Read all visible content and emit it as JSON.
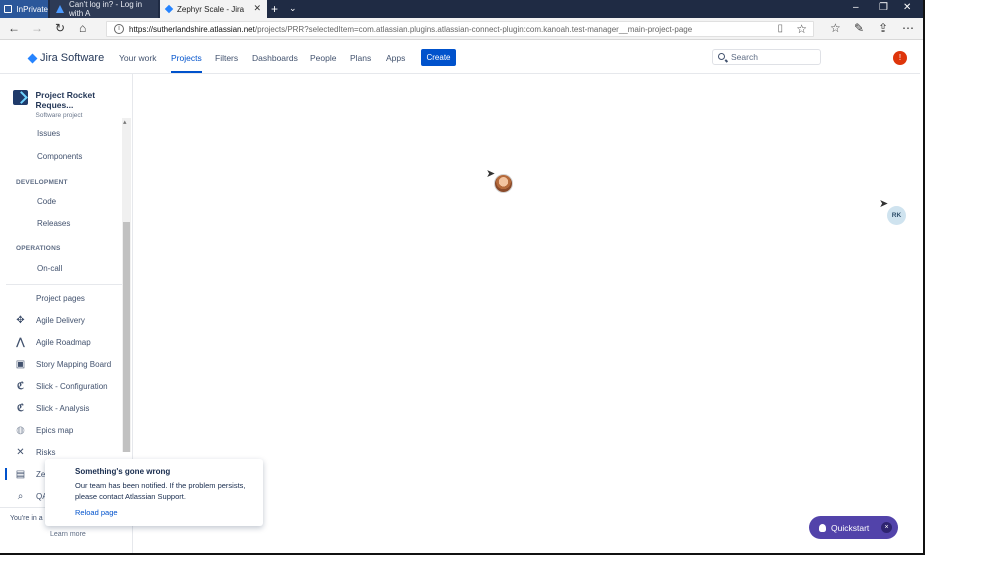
{
  "browser": {
    "inprivate_label": "InPrivate",
    "tabs": [
      {
        "title": "Can't log in? - Log in with A",
        "active": false
      },
      {
        "title": "Zephyr Scale - Jira",
        "active": true
      }
    ],
    "url_host": "https://sutherlandshire.atlassian.net",
    "url_path": "/projects/PRR?selectedItem=com.atlassian.plugins.atlassian-connect-plugin:com.kanoah.test-manager__main-project-page"
  },
  "jira_nav": {
    "brand": "Jira Software",
    "items": [
      "Your work",
      "Projects",
      "Filters",
      "Dashboards",
      "People",
      "Plans",
      "Apps"
    ],
    "active": "Projects",
    "create_label": "Create",
    "search_placeholder": "Search",
    "notification_badge": "!"
  },
  "sidebar": {
    "project_title": "Project Rocket Reques...",
    "project_subtitle": "Software project",
    "items_top": [
      "Issues",
      "Components"
    ],
    "development_header": "DEVELOPMENT",
    "development_items": [
      "Code",
      "Releases"
    ],
    "operations_header": "OPERATIONS",
    "operations_items": [
      "On-call"
    ],
    "project_pages_label": "Project pages",
    "apps": [
      "Agile Delivery",
      "Agile Roadmap",
      "Story Mapping Board",
      "Slick - Configuration",
      "Slick - Analysis",
      "Epics map",
      "Risks",
      "Ze",
      "QA"
    ],
    "footer_text": "You're in a",
    "learn_more": "Learn more"
  },
  "main": {
    "collaborator_initials": "RK"
  },
  "error_flag": {
    "title": "Something's gone wrong",
    "body": "Our team has been notified. If the problem persists, please contact Atlassian Support.",
    "action": "Reload page"
  },
  "quickstart": {
    "label": "Quickstart",
    "close": "×"
  },
  "colors": {
    "jira_blue": "#0052cc",
    "quickstart_purple": "#5243aa",
    "notification_red": "#de350b"
  }
}
